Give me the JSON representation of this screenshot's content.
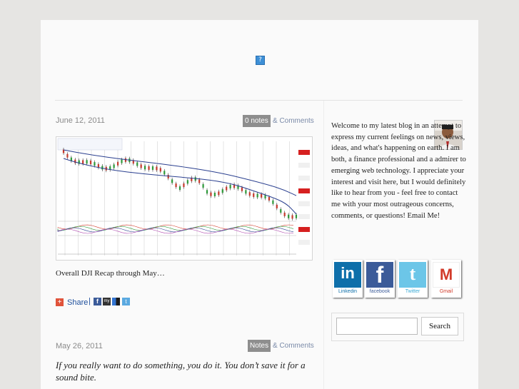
{
  "header": {
    "broken_image_glyph": "?"
  },
  "posts": [
    {
      "date": "June 12, 2011",
      "notes_label": "0 notes",
      "comments_label": "& Comments",
      "caption": "Overall DJI Recap through May…",
      "share_label": "Share"
    },
    {
      "date": "May 26, 2011",
      "notes_label": "Notes",
      "comments_label": "& Comments",
      "quote": "If you really want to do something, you do it. You don’t save it for a sound bite."
    }
  ],
  "sidebar": {
    "bio": "Welcome to my latest blog in an attempt to express my current feelings on news, views, ideas, and what's happening on earth. I am both, a finance professional and a admirer to emerging web technology. I appreciate your interest and visit here, but I would definitely like to hear from you - feel free to contact me with your most outrageous concerns, comments, or questions! Email Me!",
    "social": [
      {
        "label": "Linkedin",
        "glyph": "in",
        "icon": "linkedin-icon",
        "color": "#0e6faa"
      },
      {
        "label": "facebook",
        "glyph": "f",
        "icon": "facebook-icon",
        "color": "#3b5b99"
      },
      {
        "label": "Twitter",
        "glyph": "t",
        "icon": "twitter-icon",
        "color": "#6cc6e8"
      },
      {
        "label": "Gmail",
        "glyph": "M",
        "icon": "gmail-icon",
        "color": "#d23b2a"
      }
    ],
    "search": {
      "button_label": "Search",
      "value": ""
    }
  },
  "colors": {
    "accent_link": "#7a8aa8",
    "badge": "#8e8e8e",
    "background": "#e6e5e3",
    "page": "#fafafa"
  }
}
